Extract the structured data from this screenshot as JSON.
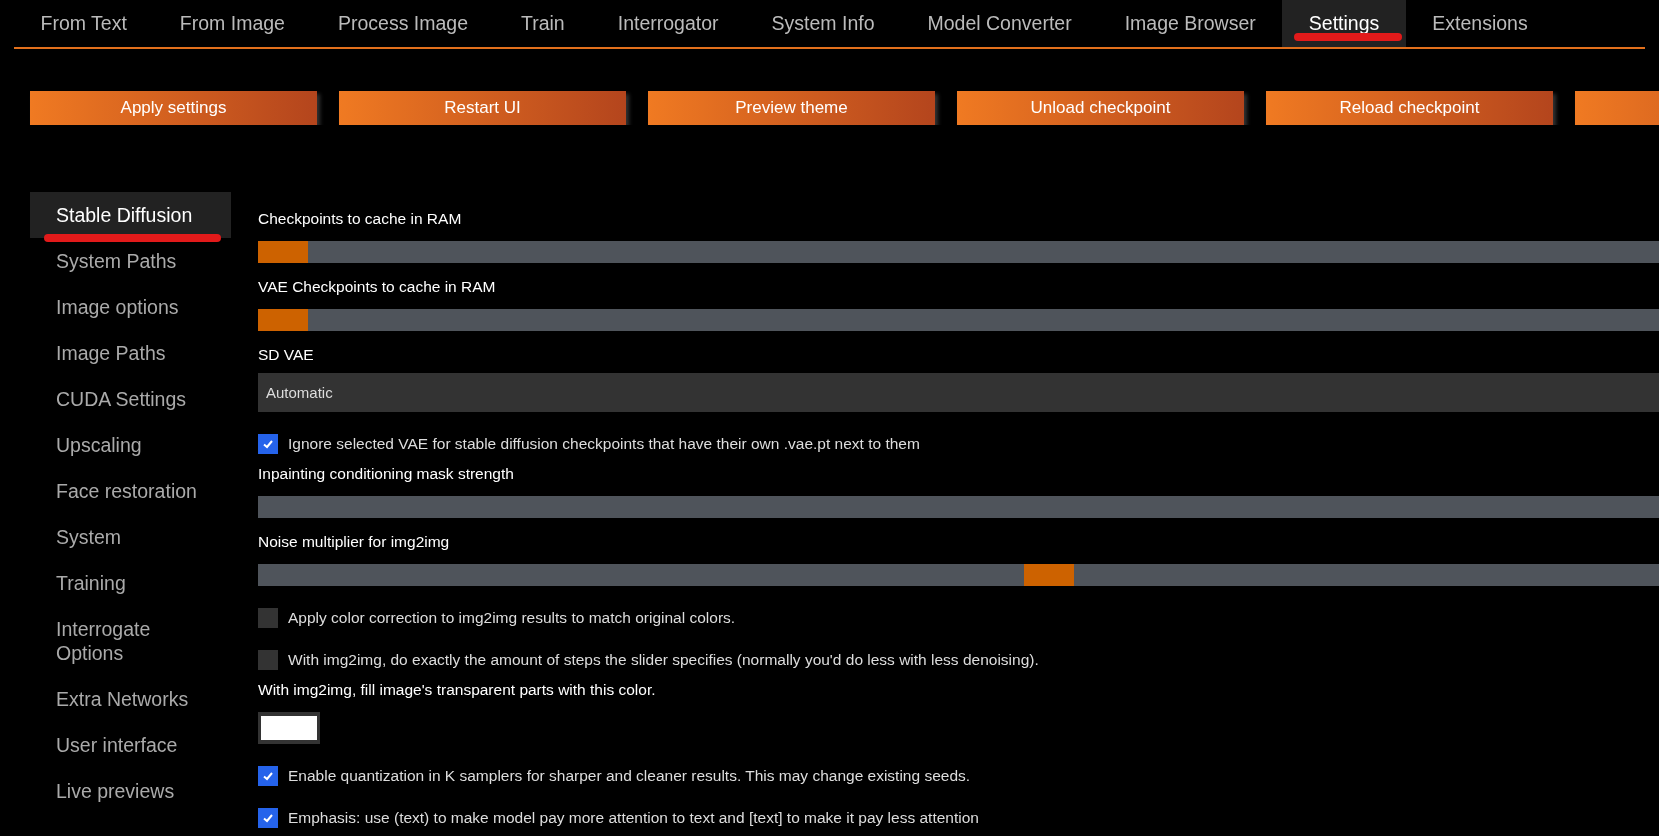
{
  "tabs": [
    {
      "label": "From Text",
      "selected": false,
      "annotated": false
    },
    {
      "label": "From Image",
      "selected": false,
      "annotated": false
    },
    {
      "label": "Process Image",
      "selected": false,
      "annotated": false
    },
    {
      "label": "Train",
      "selected": false,
      "annotated": false
    },
    {
      "label": "Interrogator",
      "selected": false,
      "annotated": false
    },
    {
      "label": "System Info",
      "selected": false,
      "annotated": false
    },
    {
      "label": "Model Converter",
      "selected": false,
      "annotated": false
    },
    {
      "label": "Image Browser",
      "selected": false,
      "annotated": false
    },
    {
      "label": "Settings",
      "selected": true,
      "annotated": true
    },
    {
      "label": "Extensions",
      "selected": false,
      "annotated": false
    }
  ],
  "actions": [
    {
      "label": "Apply settings"
    },
    {
      "label": "Restart UI"
    },
    {
      "label": "Preview theme"
    },
    {
      "label": "Unload checkpoint"
    },
    {
      "label": "Reload checkpoint"
    }
  ],
  "partial_button_at_edge": true,
  "sidebar": {
    "items": [
      {
        "label": "Stable Diffusion",
        "selected": true,
        "annotated": true
      },
      {
        "label": "System Paths",
        "selected": false,
        "annotated": false
      },
      {
        "label": "Image options",
        "selected": false,
        "annotated": false
      },
      {
        "label": "Image Paths",
        "selected": false,
        "annotated": false
      },
      {
        "label": "CUDA Settings",
        "selected": false,
        "annotated": false
      },
      {
        "label": "Upscaling",
        "selected": false,
        "annotated": false
      },
      {
        "label": "Face restoration",
        "selected": false,
        "annotated": false
      },
      {
        "label": "System",
        "selected": false,
        "annotated": false
      },
      {
        "label": "Training",
        "selected": false,
        "annotated": false
      },
      {
        "label": "Interrogate Options",
        "selected": false,
        "annotated": false
      },
      {
        "label": "Extra Networks",
        "selected": false,
        "annotated": false
      },
      {
        "label": "User interface",
        "selected": false,
        "annotated": false
      },
      {
        "label": "Live previews",
        "selected": false,
        "annotated": false
      }
    ]
  },
  "settings": [
    {
      "kind": "slider",
      "label": "Checkpoints to cache in RAM",
      "level": 0
    },
    {
      "kind": "slider",
      "label": "VAE Checkpoints to cache in RAM",
      "level": 0
    },
    {
      "kind": "dropdown",
      "label": "SD VAE",
      "value": "Automatic"
    },
    {
      "kind": "checkbox",
      "label": "Ignore selected VAE for stable diffusion checkpoints that have their own .vae.pt next to them",
      "checked": true
    },
    {
      "kind": "slider",
      "label": "Inpainting conditioning mask strength"
    },
    {
      "kind": "slider",
      "label": "Noise multiplier for img2img",
      "level": 0.567
    },
    {
      "kind": "checkbox",
      "label": "Apply color correction to img2img results to match original colors.",
      "checked": false
    },
    {
      "kind": "checkbox",
      "label": "With img2img, do exactly the amount of steps the slider specifies (normally you'd do less with less denoising).",
      "checked": false
    },
    {
      "kind": "color",
      "label": "With img2img, fill image's transparent parts with this color.",
      "color": "#ffffff"
    },
    {
      "kind": "checkbox",
      "label": "Enable quantization in K samplers for sharper and cleaner results. This may change existing seeds.",
      "checked": true
    },
    {
      "kind": "checkbox",
      "label": "Emphasis: use (text) to make model pay more attention to text and [text] to make it pay less attention",
      "checked": true
    }
  ]
}
